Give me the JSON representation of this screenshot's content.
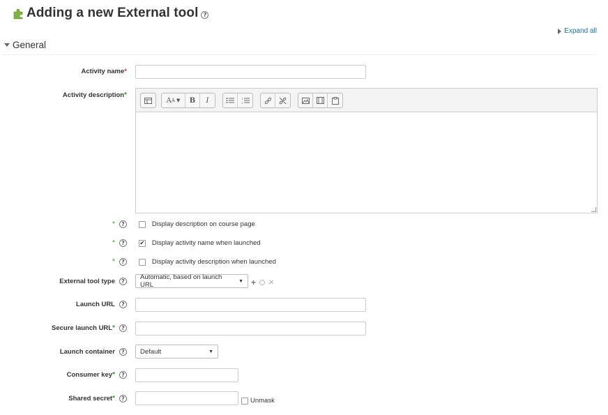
{
  "page": {
    "title": "Adding a new External tool",
    "expand_all": "Expand all",
    "section": "General"
  },
  "form": {
    "activity_name_label": "Activity name",
    "activity_description_label": "Activity description",
    "required_marker": "*",
    "editor_toolbar": [
      "Insert",
      "Font",
      "Bold",
      "Italic",
      "Unordered list",
      "Ordered list",
      "Link",
      "Unlink",
      "Image",
      "Media",
      "Paste"
    ],
    "checkboxes": [
      {
        "label": "Display description on course page",
        "checked": false,
        "check_glyph": ""
      },
      {
        "label": "Display activity name when launched",
        "checked": true,
        "check_glyph": "✔"
      },
      {
        "label": "Display activity description when launched",
        "checked": false,
        "check_glyph": ""
      }
    ],
    "tool_type_label": "External tool type",
    "tool_type_value": "Automatic, based on launch URL",
    "launch_url_label": "Launch URL",
    "secure_launch_url_label": "Secure launch URL",
    "launch_container_label": "Launch container",
    "launch_container_value": "Default",
    "consumer_key_label": "Consumer key",
    "shared_secret_label": "Shared secret",
    "unmask_label": "Unmask"
  },
  "colors": {
    "accent_link": "#1a73a8",
    "required": "#cc3333",
    "advanced": "#2e9e2e",
    "puzzle": "#7cb342"
  }
}
